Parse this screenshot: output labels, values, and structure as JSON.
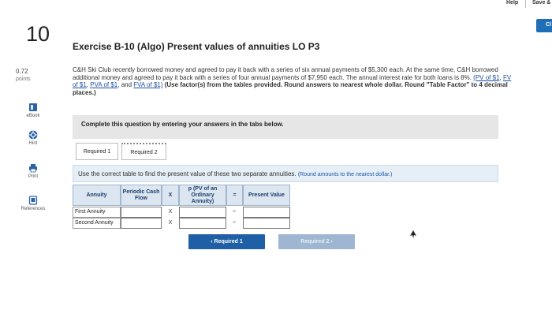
{
  "topbar": {
    "help_label": "Help",
    "save_label": "Save &",
    "check_label": "Cl"
  },
  "question": {
    "number": "10",
    "points_value": "0.72",
    "points_label": "points"
  },
  "sidebar": {
    "ebook": "eBook",
    "hint": "Hint",
    "print": "Print",
    "references": "References"
  },
  "exercise": {
    "title": "Exercise B-10 (Algo) Present values of annuities LO P3",
    "prompt_text": "C&H Ski Club recently borrowed money and agreed to pay it back with a series of six annual payments of $5,300 each. At the same time, C&H borrowed additional money and agreed to pay it back with a series of four annual payments of $7,950 each. The annual interest rate for both loans is 8%. ",
    "links": [
      "(PV of $1",
      "FV of $1",
      "PVA of $1",
      "and",
      "FVA of $1)"
    ],
    "bold_instruction": "(Use factor(s) from the tables provided. Round answers to nearest whole dollar. Round \"Table Factor\" to 4 decimal places.)"
  },
  "instruction_bar": "Complete this question by entering your answers in the tabs below.",
  "tabs": [
    {
      "label": "Required 1"
    },
    {
      "label": "Required 2"
    }
  ],
  "question_bar": {
    "text": "Use the correct table to find the present value of these two separate annuities.",
    "note": "(Round amounts to the nearest dollar.)"
  },
  "table": {
    "headers": {
      "annuity": "Annuity",
      "periodic": "Periodic Cash Flow",
      "times": "X",
      "factor": "p (PV of an Ordinary Annuity)",
      "equals": "=",
      "pv": "Present Value"
    },
    "rows": [
      {
        "label": "First Annuity",
        "op": "X",
        "eq": "="
      },
      {
        "label": "Second Annuity",
        "op": "X",
        "eq": "="
      }
    ]
  },
  "nav": {
    "prev_label": "‹  Required 1",
    "next_label": "Required 2  ›"
  }
}
